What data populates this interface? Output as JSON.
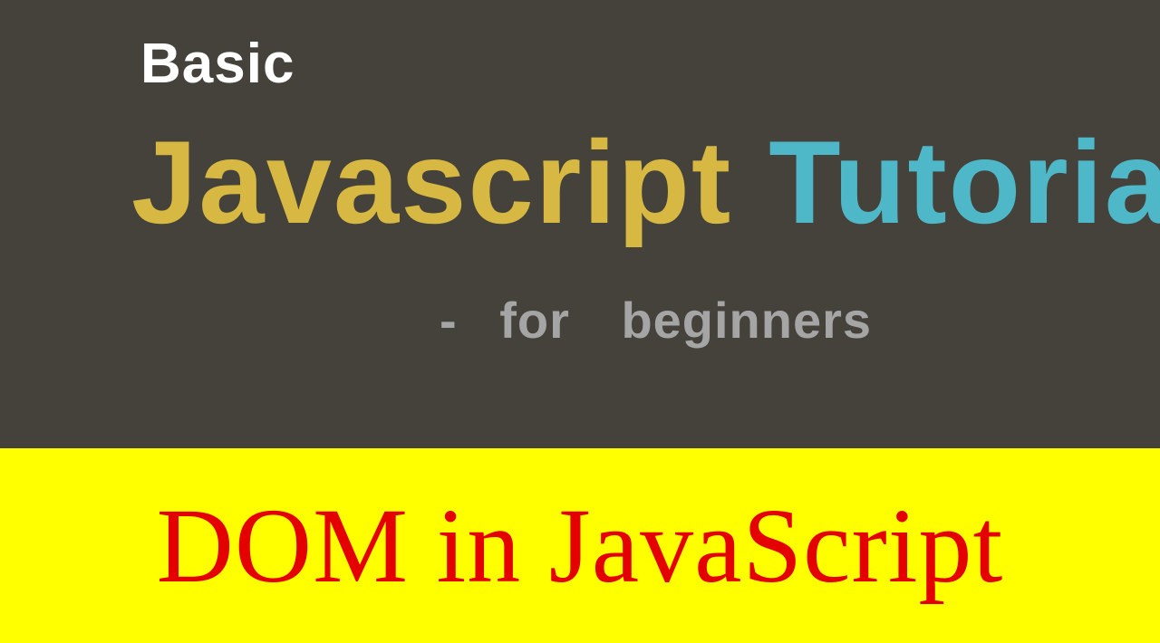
{
  "top": {
    "basic": "Basic",
    "javascript": "Javascript",
    "tutorial": "Tutorial",
    "dash": "-",
    "for": "for",
    "beginners": "beginners"
  },
  "bottom": {
    "title": "DOM in JavaScript"
  },
  "colors": {
    "background_top": "#45423b",
    "background_bottom": "#ffff00",
    "text_white": "#ffffff",
    "text_yellow": "#d6b842",
    "text_teal": "#4fb8c8",
    "text_gray": "#a5a5a5",
    "text_red": "#e50000"
  }
}
